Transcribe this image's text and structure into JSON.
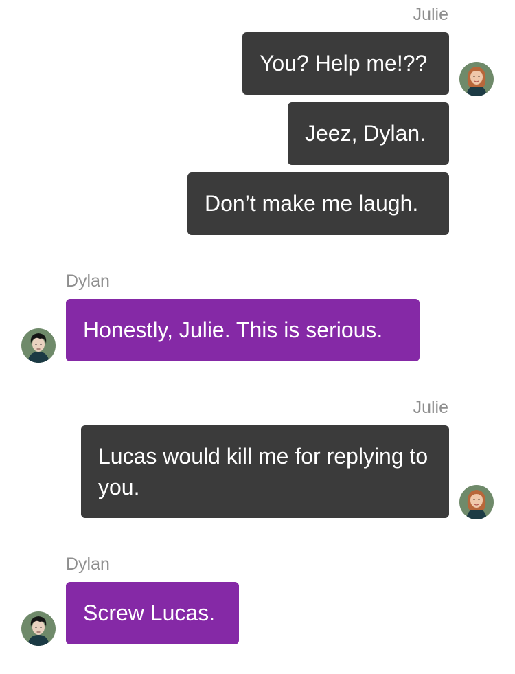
{
  "colors": {
    "julie_bubble": "#3b3b3b",
    "dylan_bubble": "#8529a6",
    "sender_name": "#8e8e8e",
    "background": "#ffffff"
  },
  "conversation": [
    {
      "sender": "Julie",
      "side": "right",
      "avatar_icon": "julie-avatar-icon",
      "messages": [
        "You? Help me!??",
        "Jeez, Dylan.",
        "Don’t make me laugh."
      ]
    },
    {
      "sender": "Dylan",
      "side": "left",
      "avatar_icon": "dylan-avatar-icon",
      "messages": [
        "Honestly, Julie. This is serious."
      ]
    },
    {
      "sender": "Julie",
      "side": "right",
      "avatar_icon": "julie-avatar-icon",
      "messages": [
        "Lucas would kill me for replying to you."
      ]
    },
    {
      "sender": "Dylan",
      "side": "left",
      "avatar_icon": "dylan-avatar-icon",
      "messages": [
        "Screw Lucas."
      ]
    }
  ]
}
